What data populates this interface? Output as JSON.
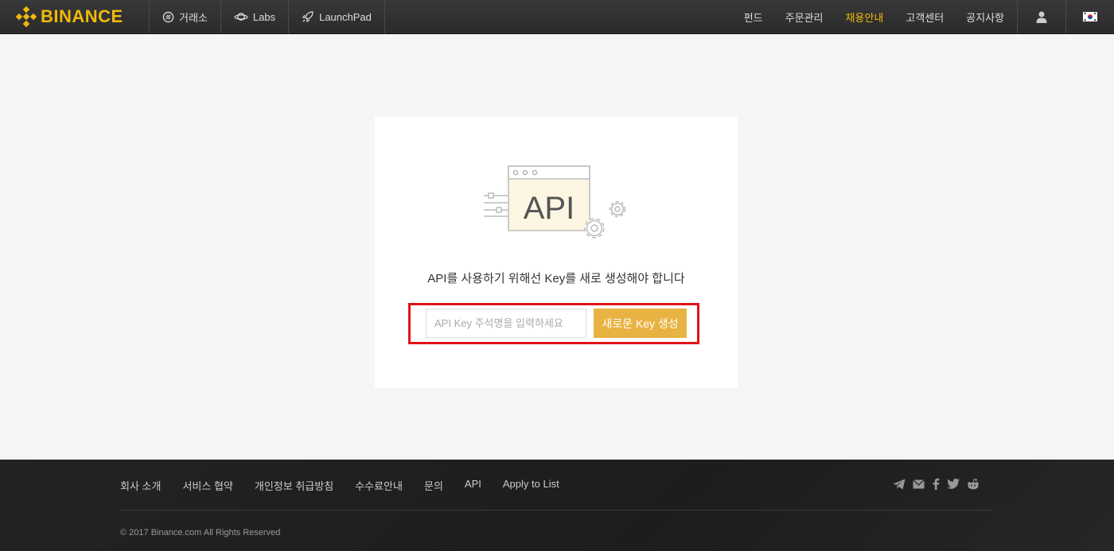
{
  "header": {
    "logo_text": "BINANCE",
    "nav_left": [
      {
        "label": "거래소",
        "icon": "exchange-icon"
      },
      {
        "label": "Labs",
        "icon": "planet-icon"
      },
      {
        "label": "LaunchPad",
        "icon": "rocket-icon"
      }
    ],
    "nav_right": [
      {
        "label": "펀드"
      },
      {
        "label": "주문관리"
      },
      {
        "label": "채용안내",
        "active": true
      },
      {
        "label": "고객센터"
      },
      {
        "label": "공지사항"
      }
    ],
    "user_icon": "user-icon",
    "language_icon": "korea-flag-icon"
  },
  "main": {
    "illustration_text": "API",
    "instruction": "API를 사용하기 위해선 Key를 새로 생성해야 합니다",
    "input_placeholder": "API Key 주석명을 입력하세요",
    "input_value": "",
    "button_label": "새로운 Key 생성"
  },
  "footer": {
    "links": [
      "회사 소개",
      "서비스 협약",
      "개인정보 취급방침",
      "수수료안내",
      "문의",
      "API",
      "Apply to List"
    ],
    "social_icons": [
      "telegram-icon",
      "mail-icon",
      "facebook-icon",
      "twitter-icon",
      "reddit-icon"
    ],
    "copyright": "© 2017 Binance.com All Rights Reserved"
  },
  "colors": {
    "accent": "#f0b90b",
    "button": "#e8b342",
    "highlight_border": "#e0131a",
    "header_bg": "#2f2f2f",
    "footer_bg": "#202020"
  }
}
